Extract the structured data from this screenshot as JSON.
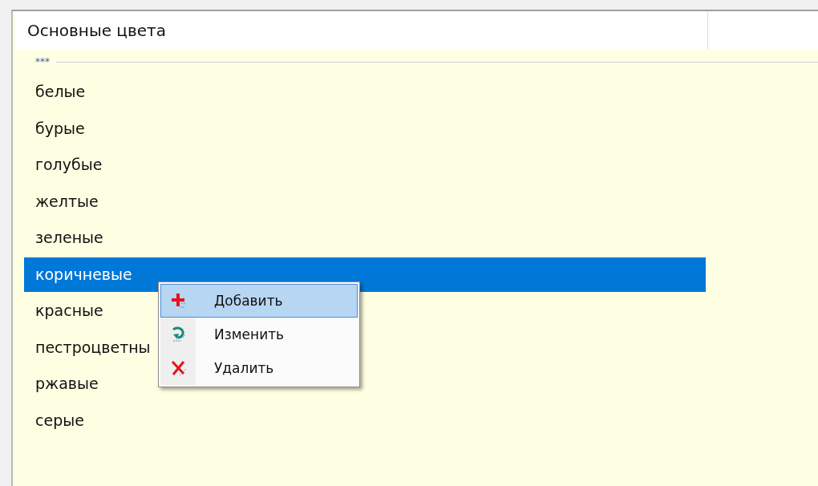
{
  "table": {
    "column_1": "Основные цвета",
    "group": "***",
    "rows": [
      {
        "label": "белые",
        "selected": false
      },
      {
        "label": "бурые",
        "selected": false
      },
      {
        "label": "голубые",
        "selected": false
      },
      {
        "label": "желтые",
        "selected": false
      },
      {
        "label": "зеленые",
        "selected": false
      },
      {
        "label": "коричневые",
        "selected": true
      },
      {
        "label": "красные",
        "selected": false
      },
      {
        "label": "пестроцветны",
        "selected": false
      },
      {
        "label": "ржавые",
        "selected": false
      },
      {
        "label": "серые",
        "selected": false
      }
    ]
  },
  "context_menu": {
    "items": [
      {
        "label": "Добавить",
        "selected": true
      },
      {
        "label": "Изменить",
        "selected": false
      },
      {
        "label": "Удалить",
        "selected": false
      }
    ]
  }
}
